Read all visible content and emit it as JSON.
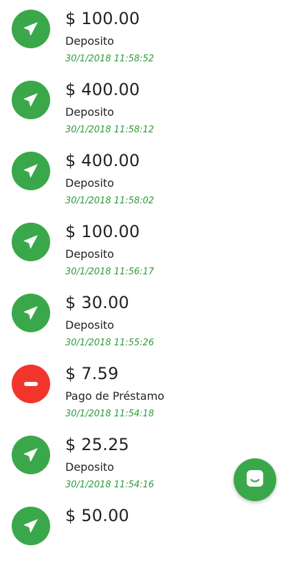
{
  "colors": {
    "deposit": "#3aa84a",
    "payment": "#f2352c",
    "date_text": "#2e9a3a",
    "chat_button": "#3aa84a"
  },
  "transactions": [
    {
      "amount": "$ 100.00",
      "type": "Deposito",
      "datetime": "30/1/2018 11:58:52",
      "icon": "send-plane-icon",
      "kind": "deposit"
    },
    {
      "amount": "$ 400.00",
      "type": "Deposito",
      "datetime": "30/1/2018 11:58:12",
      "icon": "send-plane-icon",
      "kind": "deposit"
    },
    {
      "amount": "$ 400.00",
      "type": "Deposito",
      "datetime": "30/1/2018 11:58:02",
      "icon": "send-plane-icon",
      "kind": "deposit"
    },
    {
      "amount": "$ 100.00",
      "type": "Deposito",
      "datetime": "30/1/2018 11:56:17",
      "icon": "send-plane-icon",
      "kind": "deposit"
    },
    {
      "amount": "$ 30.00",
      "type": "Deposito",
      "datetime": "30/1/2018 11:55:26",
      "icon": "send-plane-icon",
      "kind": "deposit"
    },
    {
      "amount": "$ 7.59",
      "type": "Pago de Préstamo",
      "datetime": "30/1/2018 11:54:18",
      "icon": "minus-circle-icon",
      "kind": "payment"
    },
    {
      "amount": "$ 25.25",
      "type": "Deposito",
      "datetime": "30/1/2018 11:54:16",
      "icon": "send-plane-icon",
      "kind": "deposit"
    },
    {
      "amount": "$ 50.00",
      "type": "",
      "datetime": "",
      "icon": "send-plane-icon",
      "kind": "deposit"
    }
  ],
  "chat_button": {
    "icon": "chat-icon"
  }
}
